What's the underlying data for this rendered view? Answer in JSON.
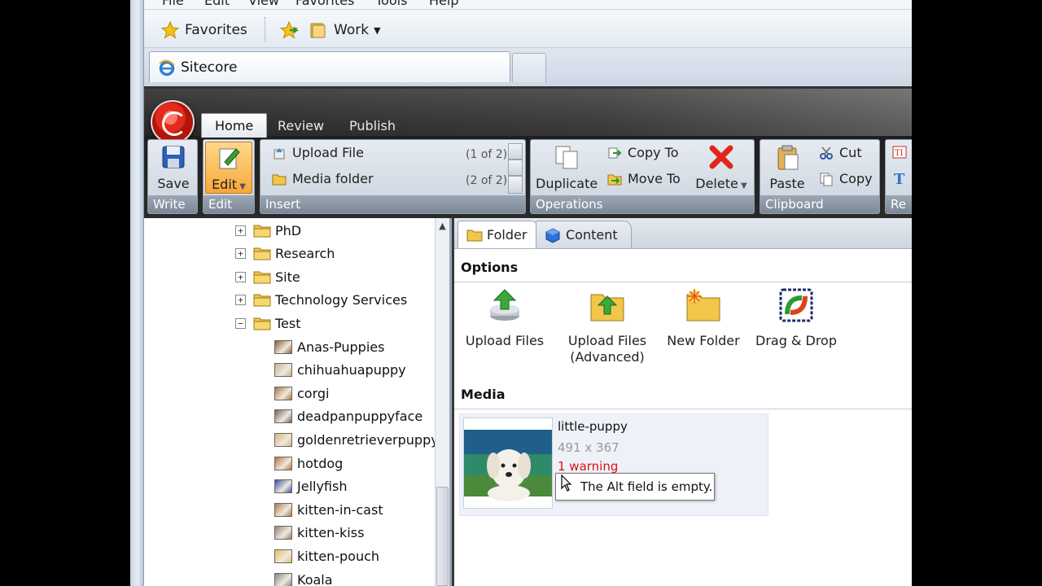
{
  "browser": {
    "menu": [
      "File",
      "Edit",
      "View",
      "Favorites",
      "Tools",
      "Help"
    ],
    "favorites_label": "Favorites",
    "work_label": "Work",
    "tab_title": "Sitecore"
  },
  "ribbon": {
    "tabs": [
      "Home",
      "Review",
      "Publish"
    ],
    "groups": {
      "write": {
        "caption": "Write",
        "save_label": "Save"
      },
      "edit": {
        "caption": "Edit",
        "edit_label": "Edit"
      },
      "insert": {
        "caption": "Insert",
        "items": [
          {
            "label": "Upload File",
            "counter": "(1 of 2)"
          },
          {
            "label": "Media folder",
            "counter": "(2 of 2)"
          }
        ]
      },
      "operations": {
        "caption": "Operations",
        "duplicate": "Duplicate",
        "copy_to": "Copy To",
        "move_to": "Move To",
        "delete": "Delete"
      },
      "clipboard": {
        "caption": "Clipboard",
        "paste": "Paste",
        "cut": "Cut",
        "copy": "Copy"
      },
      "rename": {
        "caption": "Re"
      }
    }
  },
  "tree": {
    "folders": [
      {
        "label": "PhD",
        "expanded": false
      },
      {
        "label": "Research",
        "expanded": false
      },
      {
        "label": "Site",
        "expanded": false
      },
      {
        "label": "Technology Services",
        "expanded": false
      },
      {
        "label": "Test",
        "expanded": true
      }
    ],
    "items": [
      {
        "label": "Anas-Puppies",
        "color": "#8a5a3a"
      },
      {
        "label": "chihuahuapuppy",
        "color": "#c9b08a"
      },
      {
        "label": "corgi",
        "color": "#a8763c"
      },
      {
        "label": "deadpanpuppyface",
        "color": "#7a6050"
      },
      {
        "label": "goldenretrieverpuppy",
        "color": "#d6b57a"
      },
      {
        "label": "hotdog",
        "color": "#c0703a"
      },
      {
        "label": "Jellyfish",
        "color": "#3a4fa8"
      },
      {
        "label": "kitten-in-cast",
        "color": "#b07848"
      },
      {
        "label": "kitten-kiss",
        "color": "#9a8070"
      },
      {
        "label": "kitten-pouch",
        "color": "#e0c060"
      },
      {
        "label": "Koala",
        "color": "#7f8a80"
      }
    ]
  },
  "panel": {
    "tabs": {
      "folder": "Folder",
      "content": "Content"
    },
    "options_heading": "Options",
    "options": [
      {
        "label": "Upload Files",
        "icon": "upload-files-icon"
      },
      {
        "label": "Upload Files\n(Advanced)",
        "icon": "upload-files-advanced-icon"
      },
      {
        "label": "New Folder",
        "icon": "new-folder-icon"
      },
      {
        "label": "Drag & Drop",
        "icon": "drag-drop-icon"
      }
    ],
    "media_heading": "Media",
    "media_item": {
      "name": "little-puppy",
      "dimensions": "491 x 367",
      "warning": "1 warning",
      "tooltip": "The Alt field is empty."
    }
  }
}
